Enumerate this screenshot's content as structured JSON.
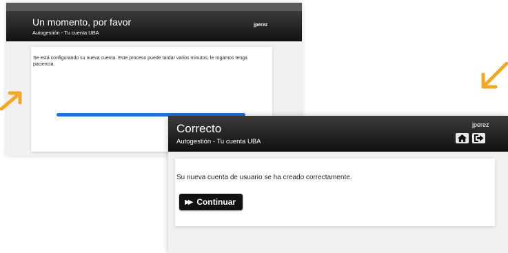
{
  "screen1": {
    "title": "Un momento, por favor",
    "subtitle": "Autogestión - Tu cuenta UBA",
    "user": "jperez",
    "message": "Se está configurando su nueva cuenta. Este proceso puede tardar varios minutos; le rogamos tenga paciencia.",
    "progress_percent": 100
  },
  "screen2": {
    "title": "Correcto",
    "subtitle": "Autogestión - Tu cuenta UBA",
    "user": "jperez",
    "message": "Su nueva cuenta de usuario se ha creado correctamente.",
    "continue_label": "Continuar",
    "icons": [
      "home-icon",
      "logout-icon"
    ]
  },
  "colors": {
    "arrow": "#f5a623",
    "progress": "#1f6fe0",
    "header_dark": "#111111"
  }
}
